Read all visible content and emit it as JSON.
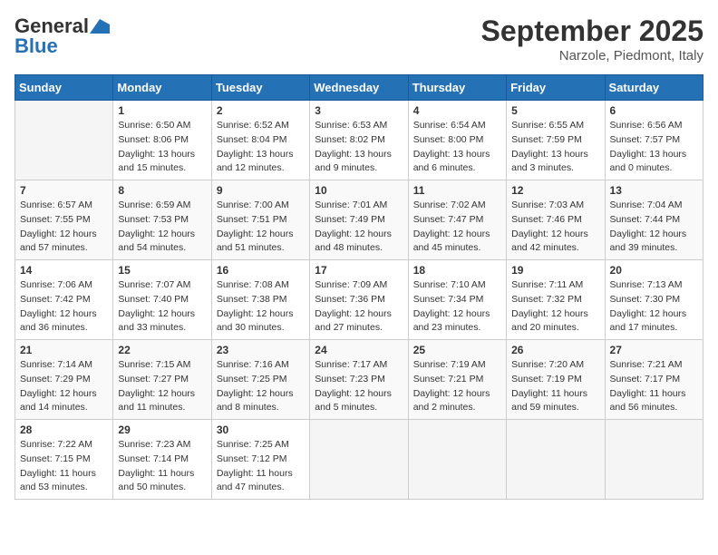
{
  "header": {
    "logo_general": "General",
    "logo_blue": "Blue",
    "title": "September 2025",
    "location": "Narzole, Piedmont, Italy"
  },
  "days_of_week": [
    "Sunday",
    "Monday",
    "Tuesday",
    "Wednesday",
    "Thursday",
    "Friday",
    "Saturday"
  ],
  "weeks": [
    [
      {
        "day": "",
        "info": ""
      },
      {
        "day": "1",
        "info": "Sunrise: 6:50 AM\nSunset: 8:06 PM\nDaylight: 13 hours\nand 15 minutes."
      },
      {
        "day": "2",
        "info": "Sunrise: 6:52 AM\nSunset: 8:04 PM\nDaylight: 13 hours\nand 12 minutes."
      },
      {
        "day": "3",
        "info": "Sunrise: 6:53 AM\nSunset: 8:02 PM\nDaylight: 13 hours\nand 9 minutes."
      },
      {
        "day": "4",
        "info": "Sunrise: 6:54 AM\nSunset: 8:00 PM\nDaylight: 13 hours\nand 6 minutes."
      },
      {
        "day": "5",
        "info": "Sunrise: 6:55 AM\nSunset: 7:59 PM\nDaylight: 13 hours\nand 3 minutes."
      },
      {
        "day": "6",
        "info": "Sunrise: 6:56 AM\nSunset: 7:57 PM\nDaylight: 13 hours\nand 0 minutes."
      }
    ],
    [
      {
        "day": "7",
        "info": "Sunrise: 6:57 AM\nSunset: 7:55 PM\nDaylight: 12 hours\nand 57 minutes."
      },
      {
        "day": "8",
        "info": "Sunrise: 6:59 AM\nSunset: 7:53 PM\nDaylight: 12 hours\nand 54 minutes."
      },
      {
        "day": "9",
        "info": "Sunrise: 7:00 AM\nSunset: 7:51 PM\nDaylight: 12 hours\nand 51 minutes."
      },
      {
        "day": "10",
        "info": "Sunrise: 7:01 AM\nSunset: 7:49 PM\nDaylight: 12 hours\nand 48 minutes."
      },
      {
        "day": "11",
        "info": "Sunrise: 7:02 AM\nSunset: 7:47 PM\nDaylight: 12 hours\nand 45 minutes."
      },
      {
        "day": "12",
        "info": "Sunrise: 7:03 AM\nSunset: 7:46 PM\nDaylight: 12 hours\nand 42 minutes."
      },
      {
        "day": "13",
        "info": "Sunrise: 7:04 AM\nSunset: 7:44 PM\nDaylight: 12 hours\nand 39 minutes."
      }
    ],
    [
      {
        "day": "14",
        "info": "Sunrise: 7:06 AM\nSunset: 7:42 PM\nDaylight: 12 hours\nand 36 minutes."
      },
      {
        "day": "15",
        "info": "Sunrise: 7:07 AM\nSunset: 7:40 PM\nDaylight: 12 hours\nand 33 minutes."
      },
      {
        "day": "16",
        "info": "Sunrise: 7:08 AM\nSunset: 7:38 PM\nDaylight: 12 hours\nand 30 minutes."
      },
      {
        "day": "17",
        "info": "Sunrise: 7:09 AM\nSunset: 7:36 PM\nDaylight: 12 hours\nand 27 minutes."
      },
      {
        "day": "18",
        "info": "Sunrise: 7:10 AM\nSunset: 7:34 PM\nDaylight: 12 hours\nand 23 minutes."
      },
      {
        "day": "19",
        "info": "Sunrise: 7:11 AM\nSunset: 7:32 PM\nDaylight: 12 hours\nand 20 minutes."
      },
      {
        "day": "20",
        "info": "Sunrise: 7:13 AM\nSunset: 7:30 PM\nDaylight: 12 hours\nand 17 minutes."
      }
    ],
    [
      {
        "day": "21",
        "info": "Sunrise: 7:14 AM\nSunset: 7:29 PM\nDaylight: 12 hours\nand 14 minutes."
      },
      {
        "day": "22",
        "info": "Sunrise: 7:15 AM\nSunset: 7:27 PM\nDaylight: 12 hours\nand 11 minutes."
      },
      {
        "day": "23",
        "info": "Sunrise: 7:16 AM\nSunset: 7:25 PM\nDaylight: 12 hours\nand 8 minutes."
      },
      {
        "day": "24",
        "info": "Sunrise: 7:17 AM\nSunset: 7:23 PM\nDaylight: 12 hours\nand 5 minutes."
      },
      {
        "day": "25",
        "info": "Sunrise: 7:19 AM\nSunset: 7:21 PM\nDaylight: 12 hours\nand 2 minutes."
      },
      {
        "day": "26",
        "info": "Sunrise: 7:20 AM\nSunset: 7:19 PM\nDaylight: 11 hours\nand 59 minutes."
      },
      {
        "day": "27",
        "info": "Sunrise: 7:21 AM\nSunset: 7:17 PM\nDaylight: 11 hours\nand 56 minutes."
      }
    ],
    [
      {
        "day": "28",
        "info": "Sunrise: 7:22 AM\nSunset: 7:15 PM\nDaylight: 11 hours\nand 53 minutes."
      },
      {
        "day": "29",
        "info": "Sunrise: 7:23 AM\nSunset: 7:14 PM\nDaylight: 11 hours\nand 50 minutes."
      },
      {
        "day": "30",
        "info": "Sunrise: 7:25 AM\nSunset: 7:12 PM\nDaylight: 11 hours\nand 47 minutes."
      },
      {
        "day": "",
        "info": ""
      },
      {
        "day": "",
        "info": ""
      },
      {
        "day": "",
        "info": ""
      },
      {
        "day": "",
        "info": ""
      }
    ]
  ]
}
